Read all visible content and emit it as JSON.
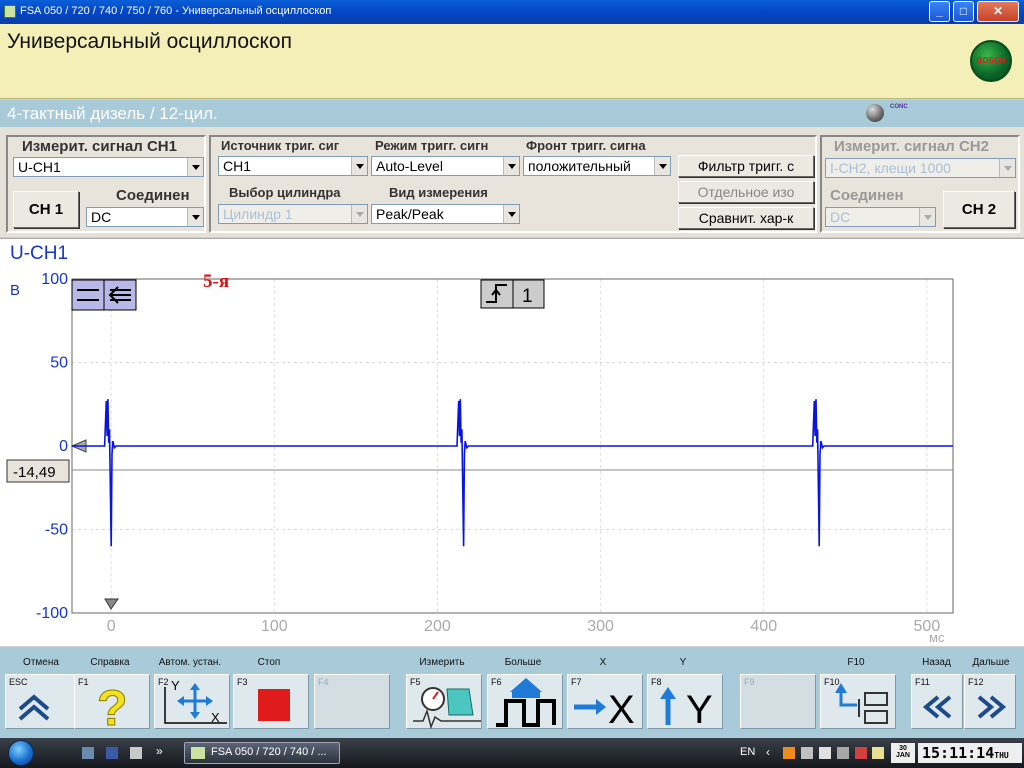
{
  "window": {
    "title": "FSA 050 / 720 / 740 / 750 / 760 - Универсальный осциллоскоп",
    "minimize": "_",
    "maximize": "□",
    "close": "✕"
  },
  "header": {
    "title": "Универсальный осциллоскоп",
    "logo_text": "BOSCH"
  },
  "subheader": {
    "engine": "4-тактный дизель / 12-цил.",
    "status_logo": "CONC"
  },
  "ch1": {
    "label": "Измерит. сигнал CH1",
    "signal": "U-CH1",
    "button": "CH 1",
    "coupling_label": "Соединен",
    "coupling": "DC"
  },
  "trigger": {
    "source_label": "Источник триг. сиг",
    "source": "CH1",
    "mode_label": "Режим тригг. сигн",
    "mode": "Auto-Level",
    "edge_label": "Фронт тригг. сигна",
    "edge": "положительный",
    "cylinder_label": "Выбор цилиндра",
    "cylinder": "Цилиндр 1",
    "measure_label": "Вид измерения",
    "measure": "Peak/Peak",
    "filter_button": "Фильтр тригг. с",
    "separate_button": "Отдельное изо",
    "compare_button": "Сравнит. хар-к"
  },
  "ch2": {
    "label": "Измерит. сигнал CH2",
    "signal": "I-CH2, клещи 1000",
    "coupling_label": "Соединен",
    "coupling": "DC",
    "button": "CH 2"
  },
  "scope": {
    "channel": "U-CH1",
    "y_unit": "В",
    "x_unit": "мс",
    "cursor_value": "-14,49",
    "annotation": "5-я",
    "trigger_channel": "1",
    "annotation_color": "#e01010",
    "trace_color": "#0a14e0"
  },
  "chart_data": {
    "type": "line",
    "title": "U-CH1",
    "xlabel": "мс",
    "ylabel": "В",
    "xlim": [
      -24,
      516
    ],
    "ylim": [
      -100,
      100
    ],
    "x_ticks": [
      0,
      100,
      200,
      300,
      400,
      500
    ],
    "y_ticks": [
      100,
      50,
      0,
      -50,
      -100
    ],
    "grid": true,
    "series": [
      {
        "x": [
          -24,
          -4,
          -3,
          -2.5,
          -2,
          -1.5,
          -1,
          0,
          0.5,
          1,
          2,
          3,
          10,
          100,
          212,
          213,
          213.5,
          214,
          214.5,
          215,
          216,
          216.5,
          217,
          218,
          219,
          226,
          300,
          430,
          431,
          431.5,
          432,
          432.5,
          433,
          434,
          434.5,
          435,
          436,
          437,
          444,
          516
        ],
        "y": [
          0,
          0,
          27,
          6,
          28,
          2,
          10,
          -60,
          -5,
          3,
          -1,
          0,
          0,
          0,
          0,
          27,
          6,
          28,
          2,
          10,
          -60,
          -5,
          3,
          -1,
          0,
          0,
          0,
          0,
          27,
          6,
          28,
          2,
          10,
          -60,
          -5,
          3,
          -1,
          0,
          0,
          0
        ]
      }
    ]
  },
  "fkeys": [
    {
      "caption": "Отмена",
      "key": "ESC"
    },
    {
      "caption": "Справка",
      "key": "F1"
    },
    {
      "caption": "Автом. устан.",
      "key": "F2"
    },
    {
      "caption": "Стоп",
      "key": "F3"
    },
    {
      "caption": "",
      "key": "F4"
    },
    {
      "caption": "Измерить",
      "key": "F5"
    },
    {
      "caption": "Больше",
      "key": "F6"
    },
    {
      "caption": "X",
      "key": "F7"
    },
    {
      "caption": "Y",
      "key": "F8"
    },
    {
      "caption": "",
      "key": "F9"
    },
    {
      "caption": "F10",
      "key": "F10"
    },
    {
      "caption": "Назад",
      "key": "F11"
    },
    {
      "caption": "Дальше",
      "key": "F12"
    }
  ],
  "taskbar": {
    "task": "FSA 050 / 720 / 740 / ...",
    "lang": "EN",
    "date_day": "30",
    "date_month": "JAN",
    "time": "15:11:14",
    "weekday": "THU"
  }
}
